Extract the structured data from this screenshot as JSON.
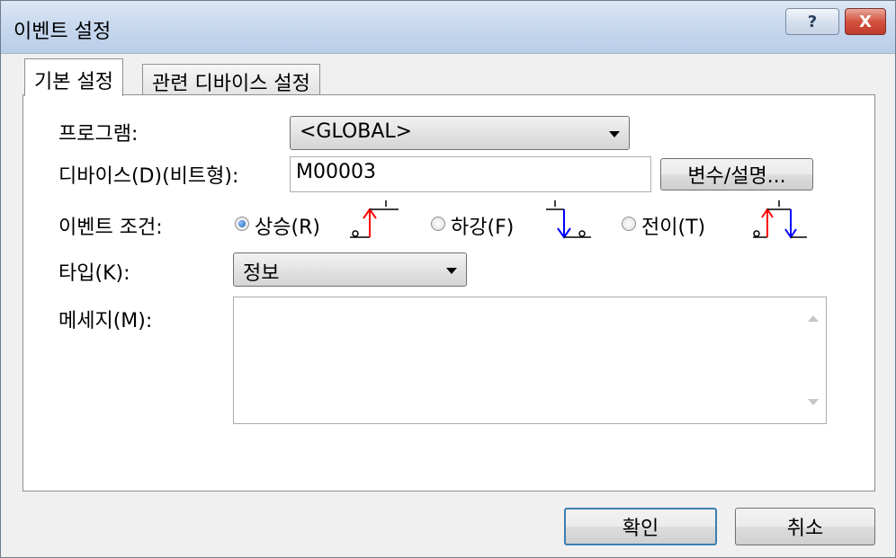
{
  "window": {
    "title": "이벤트 설정",
    "help_label": "?",
    "close_label": "X"
  },
  "tabs": [
    {
      "label": "기본 설정",
      "active": true
    },
    {
      "label": "관련 디바이스 설정",
      "active": false
    }
  ],
  "form": {
    "program_label": "프로그램:",
    "program_value": "<GLOBAL>",
    "device_label": "디바이스(D)(비트형):",
    "device_value": "M00003",
    "var_button_label": "변수/설명...",
    "condition_label": "이벤트 조건:",
    "condition_options": [
      {
        "label": "상승(R)",
        "checked": true
      },
      {
        "label": "하강(F)",
        "checked": false
      },
      {
        "label": "전이(T)",
        "checked": false
      }
    ],
    "type_label": "타입(K):",
    "type_value": "정보",
    "message_label": "메세지(M):",
    "message_value": ""
  },
  "buttons": {
    "ok_label": "확인",
    "cancel_label": "취소"
  },
  "colors": {
    "rising_edge": "#ff0000",
    "falling_edge": "#0000ff",
    "default_button_border": "#3c7fb1"
  }
}
